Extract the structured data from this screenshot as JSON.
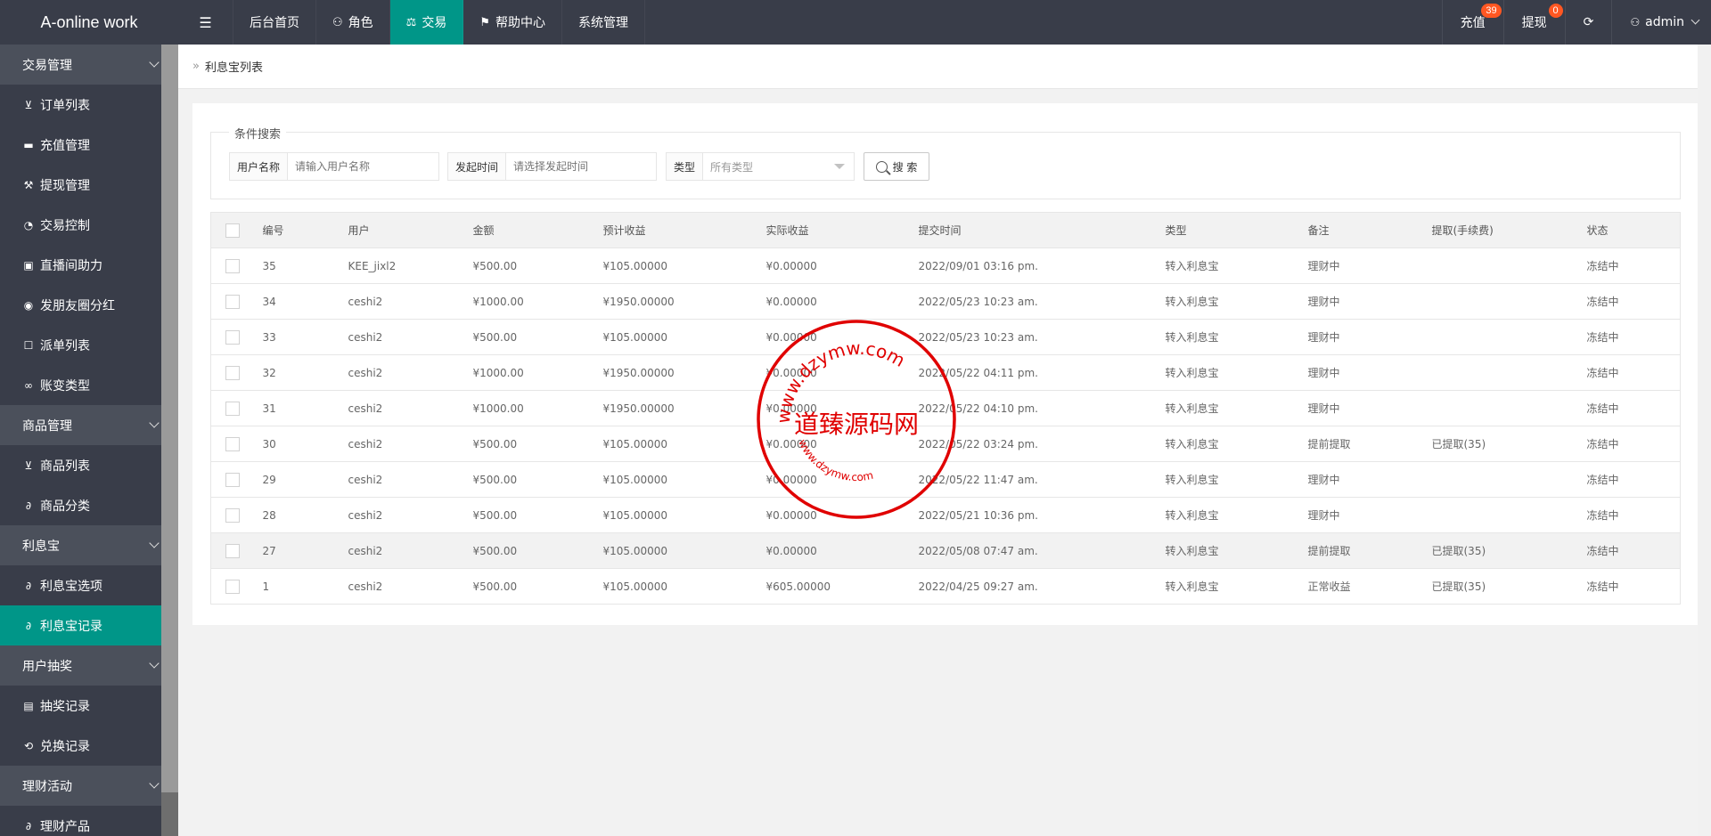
{
  "app": {
    "title": "A-online work"
  },
  "header": {
    "toggle_icon": "menu-fold-icon",
    "nav": [
      {
        "label": "后台首页",
        "icon": ""
      },
      {
        "label": "角色",
        "icon": "user-icon"
      },
      {
        "label": "交易",
        "icon": "scale-icon",
        "active": true
      },
      {
        "label": "帮助中心",
        "icon": "flag-icon"
      },
      {
        "label": "系统管理",
        "icon": ""
      }
    ],
    "recharge_label": "充值",
    "recharge_count": "39",
    "withdraw_label": "提现",
    "withdraw_count": "0",
    "refresh_icon": "refresh-icon",
    "user_label": "admin",
    "accent_color": "#009688",
    "badge_color": "#ff5722"
  },
  "sidebar": {
    "groups": [
      {
        "label": "交易管理",
        "items": [
          {
            "label": "订单列表",
            "icon": "cart-icon"
          },
          {
            "label": "充值管理",
            "icon": "card-icon"
          },
          {
            "label": "提现管理",
            "icon": "gavel-icon"
          },
          {
            "label": "交易控制",
            "icon": "dashboard-icon"
          },
          {
            "label": "直播间助力",
            "icon": "play-icon"
          },
          {
            "label": "发朋友圈分红",
            "icon": "camera-icon"
          },
          {
            "label": "派单列表",
            "icon": "book-icon"
          },
          {
            "label": "账变类型",
            "icon": "link-icon"
          }
        ]
      },
      {
        "label": "商品管理",
        "items": [
          {
            "label": "商品列表",
            "icon": "cart-icon"
          },
          {
            "label": "商品分类",
            "icon": "link-icon"
          }
        ]
      },
      {
        "label": "利息宝",
        "items": [
          {
            "label": "利息宝选项",
            "icon": "link-icon"
          },
          {
            "label": "利息宝记录",
            "icon": "link-icon",
            "active": true
          }
        ]
      },
      {
        "label": "用户抽奖",
        "items": [
          {
            "label": "抽奖记录",
            "icon": "clipboard-icon"
          },
          {
            "label": "兑换记录",
            "icon": "refresh-icon"
          }
        ]
      },
      {
        "label": "理财活动",
        "items": [
          {
            "label": "理财产品",
            "icon": "link-icon"
          }
        ]
      }
    ]
  },
  "breadcrumb": {
    "current": "利息宝列表"
  },
  "search": {
    "legend": "条件搜索",
    "username_label": "用户名称",
    "username_placeholder": "请输入用户名称",
    "time_label": "发起时间",
    "time_placeholder": "请选择发起时间",
    "type_label": "类型",
    "type_value": "所有类型",
    "button_label": "搜 索"
  },
  "table": {
    "columns": [
      "编号",
      "用户",
      "金额",
      "预计收益",
      "实际收益",
      "提交时间",
      "类型",
      "备注",
      "提取(手续费)",
      "状态"
    ],
    "rows": [
      [
        "35",
        "KEE_jixl2",
        "¥500.00",
        "¥105.00000",
        "¥0.00000",
        "2022/09/01 03:16 pm.",
        "转入利息宝",
        "理财中",
        "",
        "冻结中"
      ],
      [
        "34",
        "ceshi2",
        "¥1000.00",
        "¥1950.00000",
        "¥0.00000",
        "2022/05/23 10:23 am.",
        "转入利息宝",
        "理财中",
        "",
        "冻结中"
      ],
      [
        "33",
        "ceshi2",
        "¥500.00",
        "¥105.00000",
        "¥0.00000",
        "2022/05/23 10:23 am.",
        "转入利息宝",
        "理财中",
        "",
        "冻结中"
      ],
      [
        "32",
        "ceshi2",
        "¥1000.00",
        "¥1950.00000",
        "¥0.00000",
        "2022/05/22 04:11 pm.",
        "转入利息宝",
        "理财中",
        "",
        "冻结中"
      ],
      [
        "31",
        "ceshi2",
        "¥1000.00",
        "¥1950.00000",
        "¥0.00000",
        "2022/05/22 04:10 pm.",
        "转入利息宝",
        "理财中",
        "",
        "冻结中"
      ],
      [
        "30",
        "ceshi2",
        "¥500.00",
        "¥105.00000",
        "¥0.00000",
        "2022/05/22 03:24 pm.",
        "转入利息宝",
        "提前提取",
        "已提取(35)",
        "冻结中"
      ],
      [
        "29",
        "ceshi2",
        "¥500.00",
        "¥105.00000",
        "¥0.00000",
        "2022/05/22 11:47 am.",
        "转入利息宝",
        "理财中",
        "",
        "冻结中"
      ],
      [
        "28",
        "ceshi2",
        "¥500.00",
        "¥105.00000",
        "¥0.00000",
        "2022/05/21 10:36 pm.",
        "转入利息宝",
        "理财中",
        "",
        "冻结中"
      ],
      [
        "27",
        "ceshi2",
        "¥500.00",
        "¥105.00000",
        "¥0.00000",
        "2022/05/08 07:47 am.",
        "转入利息宝",
        "提前提取",
        "已提取(35)",
        "冻结中"
      ],
      [
        "1",
        "ceshi2",
        "¥500.00",
        "¥105.00000",
        "¥605.00000",
        "2022/04/25 09:27 am.",
        "转入利息宝",
        "正常收益",
        "已提取(35)",
        "冻结中"
      ]
    ],
    "highlight_row": 8
  },
  "watermark": {
    "center_text": "道臻源码网",
    "ring_text_top": "www.dzymw.com",
    "ring_text_bottom": "www.dzymw.com",
    "color": "#e00000"
  }
}
